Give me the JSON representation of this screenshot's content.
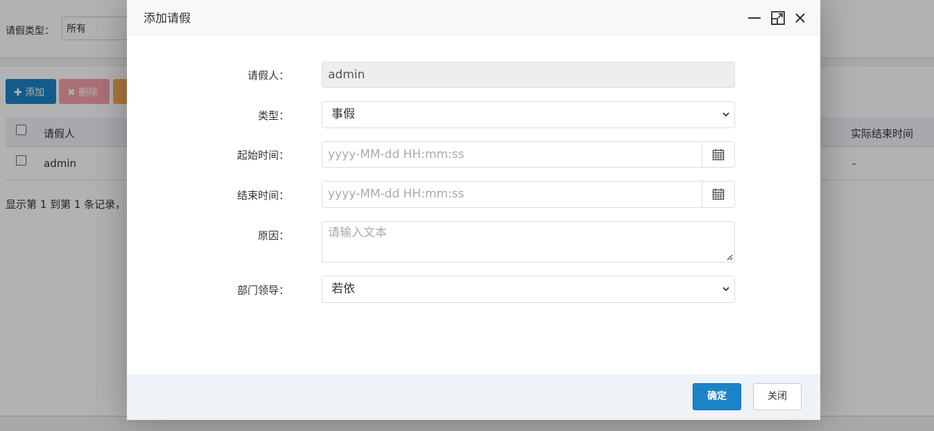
{
  "background": {
    "search": {
      "label": "请假类型：",
      "select_value": "所有"
    },
    "toolbar": {
      "add_label": "添加",
      "delete_label": "删除"
    },
    "table": {
      "headers": {
        "applicant": "请假人",
        "actual_end": "实际结束时间"
      },
      "rows": [
        {
          "applicant": "admin",
          "actual_end": "-"
        }
      ]
    },
    "pager_text": "显示第 1 到第 1 条记录，"
  },
  "dialog": {
    "title": "添加请假",
    "icons": {
      "minimize": "minimize-icon",
      "maximize": "maximize-icon",
      "close": "close-icon",
      "calendar": "calendar-icon"
    },
    "fields": {
      "applicant": {
        "label": "请假人：",
        "value": "admin"
      },
      "type": {
        "label": "类型：",
        "value": "事假"
      },
      "start_time": {
        "label": "起始时间：",
        "placeholder": "yyyy-MM-dd HH:mm:ss"
      },
      "end_time": {
        "label": "结束时间：",
        "placeholder": "yyyy-MM-dd HH:mm:ss"
      },
      "reason": {
        "label": "原因：",
        "placeholder": "请输入文本"
      },
      "leader": {
        "label": "部门领导：",
        "value": "若依"
      }
    },
    "footer": {
      "confirm_label": "确定",
      "close_label": "关闭"
    }
  },
  "colors": {
    "primary": "#1c84c6",
    "danger": "#ed5565",
    "warning": "#f8ac59"
  }
}
